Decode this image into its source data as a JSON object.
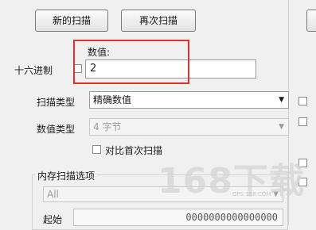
{
  "buttons": {
    "new_scan": "新的扫描",
    "next_scan": "再次扫描"
  },
  "value_field": {
    "label": "数值:",
    "value": "2"
  },
  "hex_label": "十六进制",
  "scan_type": {
    "label": "扫描类型",
    "selected": "精确数值"
  },
  "value_type": {
    "label": "数值类型",
    "selected": "4 字节"
  },
  "compare_first_label": "对比首次扫描",
  "memory_options": {
    "label": "内存扫描选项",
    "region": "All",
    "start_label": "起始",
    "start_value": "0000000000000000"
  },
  "watermark": {
    "text": "168下载",
    "subtext": "GPS 168.COM"
  },
  "highlight_color": "#e03030"
}
